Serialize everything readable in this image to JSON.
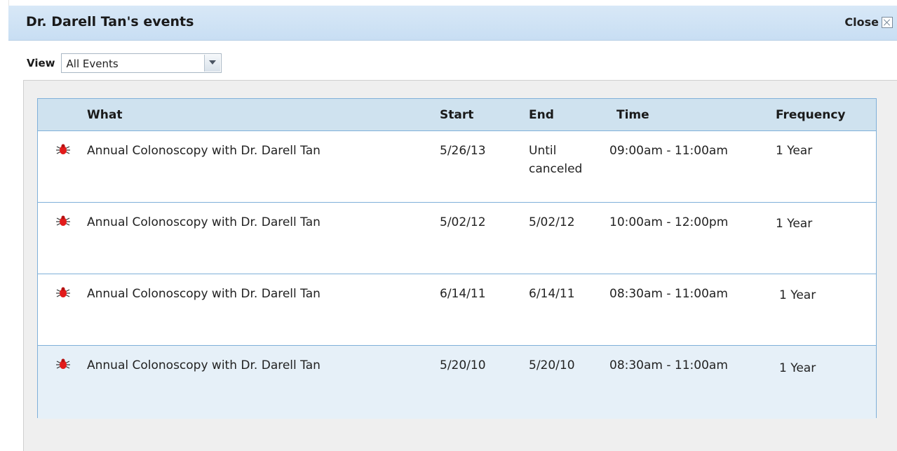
{
  "dialog": {
    "title": "Dr. Darell Tan's events",
    "close_label": "Close"
  },
  "view": {
    "label": "View",
    "selected": "All Events"
  },
  "table": {
    "columns": {
      "what": "What",
      "start": "Start",
      "end": "End",
      "time": "Time",
      "frequency": "Frequency"
    },
    "rows": [
      {
        "icon": "bug-icon",
        "what": "Annual Colonoscopy with Dr. Darell Tan",
        "start": "5/26/13",
        "end_line1": "Until",
        "end_line2": "canceled",
        "time": "09:00am - 11:00am",
        "frequency": "1 Year"
      },
      {
        "icon": "bug-icon",
        "what": "Annual Colonoscopy with Dr. Darell Tan",
        "start": "5/02/12",
        "end_line1": "5/02/12",
        "end_line2": "",
        "time": "10:00am - 12:00pm",
        "frequency": "1 Year"
      },
      {
        "icon": "bug-icon",
        "what": "Annual Colonoscopy with Dr. Darell Tan",
        "start": "6/14/11",
        "end_line1": "6/14/11",
        "end_line2": "",
        "time": "08:30am - 11:00am",
        "frequency": "1 Year"
      },
      {
        "icon": "bug-icon",
        "what": "Annual Colonoscopy with Dr. Darell Tan",
        "start": "5/20/10",
        "end_line1": "5/20/10",
        "end_line2": "",
        "time": "08:30am - 11:00am",
        "frequency": "1 Year"
      }
    ]
  },
  "colors": {
    "titlebar": "#c8def3",
    "header": "#cfe2ef",
    "border": "#7fb0d9",
    "selected_row": "#e6f0f8"
  }
}
